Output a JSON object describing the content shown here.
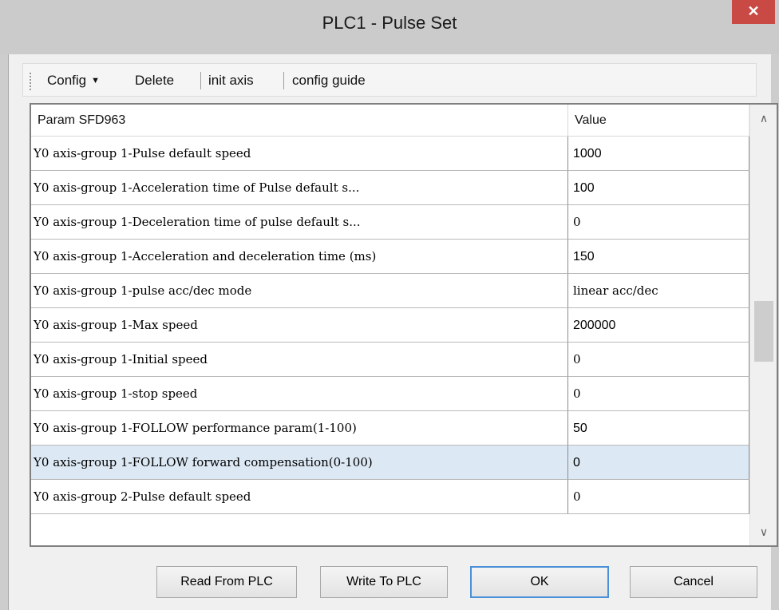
{
  "window": {
    "title": "PLC1 - Pulse  Set",
    "close_glyph": "✕"
  },
  "toolbar": {
    "config_label": "Config",
    "delete_label": "Delete",
    "init_axis_label": "init axis",
    "config_guide_label": "config guide"
  },
  "grid": {
    "columns": {
      "param": "Param SFD963",
      "value": "Value"
    },
    "rows": [
      {
        "param": "Y0 axis-group 1-Pulse default speed",
        "value": "1000"
      },
      {
        "param": "Y0 axis-group 1-Acceleration time of Pulse default s...",
        "value": "100"
      },
      {
        "param": "Y0 axis-group 1-Deceleration time of pulse default s...",
        "value": "0"
      },
      {
        "param": "Y0 axis-group 1-Acceleration and deceleration time (ms)",
        "value": "150"
      },
      {
        "param": "Y0 axis-group 1-pulse acc/dec mode",
        "value": "linear acc/dec"
      },
      {
        "param": "Y0 axis-group 1-Max speed",
        "value": "200000"
      },
      {
        "param": "Y0 axis-group 1-Initial speed",
        "value": "0"
      },
      {
        "param": "Y0 axis-group 1-stop speed",
        "value": "0"
      },
      {
        "param": "Y0 axis-group 1-FOLLOW performance param(1-100)",
        "value": "50"
      },
      {
        "param": "Y0 axis-group 1-FOLLOW forward compensation(0-100)",
        "value": "0"
      },
      {
        "param": "Y0 axis-group 2-Pulse default speed",
        "value": "0"
      }
    ],
    "selected_row_index": 9
  },
  "buttons": {
    "read_label": "Read From PLC",
    "write_label": "Write To PLC",
    "ok_label": "OK",
    "cancel_label": "Cancel"
  }
}
